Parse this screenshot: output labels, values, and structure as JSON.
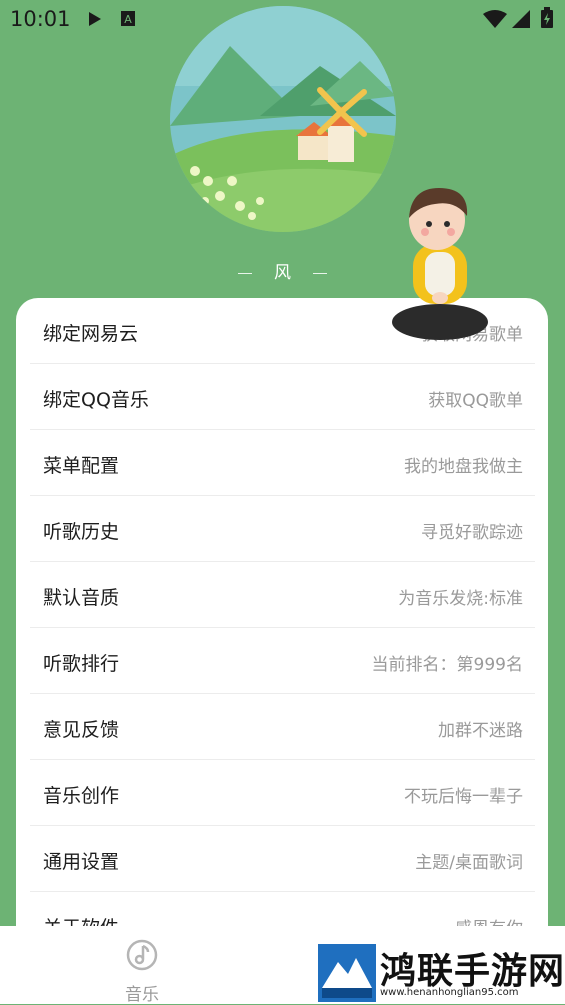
{
  "status_bar": {
    "time": "10:01"
  },
  "profile": {
    "name": "风"
  },
  "menu": [
    {
      "label": "绑定网易云",
      "value": "获取网易歌单"
    },
    {
      "label": "绑定QQ音乐",
      "value": "获取QQ歌单"
    },
    {
      "label": "菜单配置",
      "value": "我的地盘我做主"
    },
    {
      "label": "听歌历史",
      "value": "寻觅好歌踪迹"
    },
    {
      "label": "默认音质",
      "value": "为音乐发烧:标准"
    },
    {
      "label": "听歌排行",
      "value": "当前排名：第999名"
    },
    {
      "label": "意见反馈",
      "value": "加群不迷路"
    },
    {
      "label": "音乐创作",
      "value": "不玩后悔一辈子"
    },
    {
      "label": "通用设置",
      "value": "主题/桌面歌词"
    },
    {
      "label": "关于软件",
      "value": "感恩有你"
    }
  ],
  "bottom_nav": {
    "music_label": "音乐"
  },
  "watermark": {
    "title": "鸿联手游网",
    "url": "www.henanhonglian95.com"
  },
  "colors": {
    "header_bg": "#6db374",
    "card_bg": "#ffffff"
  }
}
